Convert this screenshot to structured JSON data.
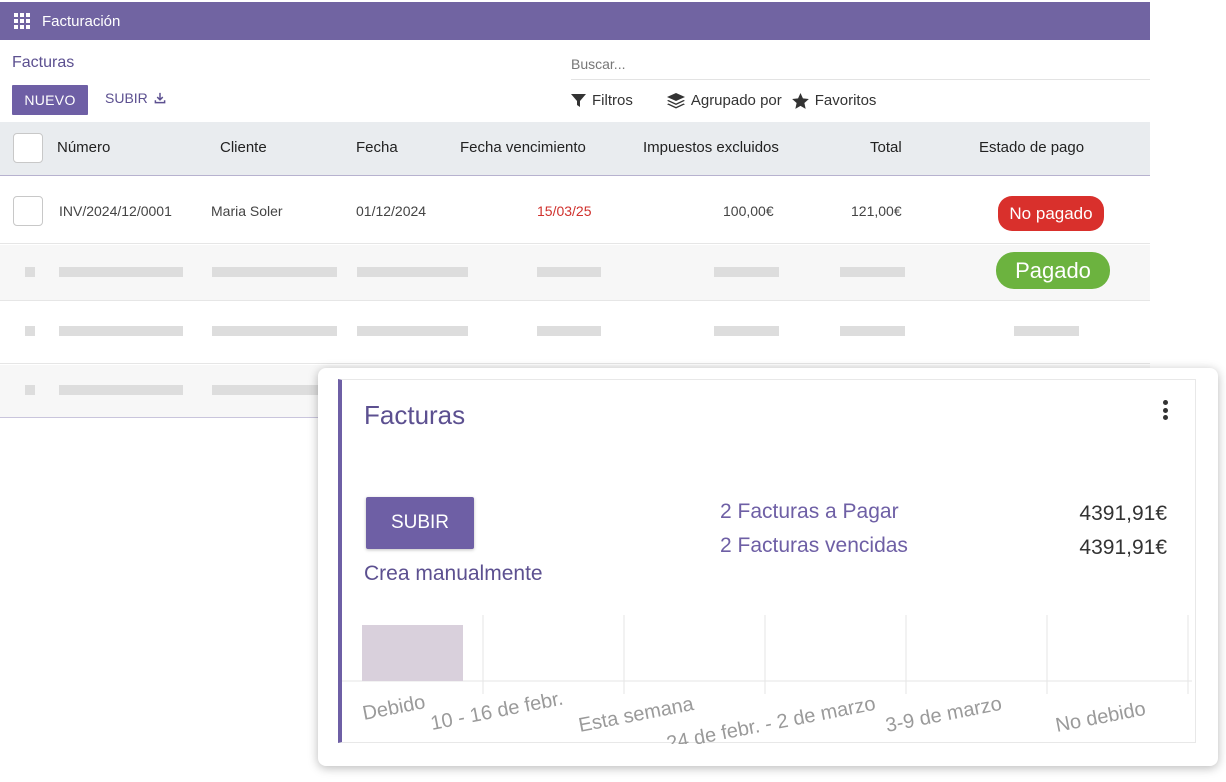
{
  "topbar": {
    "app_title": "Facturación",
    "apps_icon": "grid-icon"
  },
  "control": {
    "breadcrumb": "Facturas",
    "new_label": "NUEVO",
    "upload_label": "SUBIR",
    "search_placeholder": "Buscar...",
    "filters": "Filtros",
    "group_by": "Agrupado por",
    "favorites": "Favoritos"
  },
  "table": {
    "columns": [
      "Número",
      "Cliente",
      "Fecha",
      "Fecha vencimiento",
      "Impuestos excluidos",
      "Total",
      "Estado de pago"
    ],
    "rows": [
      {
        "number": "INV/2024/12/0001",
        "client": "Maria Soler",
        "date": "01/12/2024",
        "due": "15/03/25",
        "untaxed": "100,00€",
        "total": "121,00€",
        "status": "No pagado"
      }
    ],
    "placeholder_status": "Pagado",
    "colors": {
      "unpaid": "#d9302c",
      "paid": "#6cb33f",
      "due_overdue": "#d0312d"
    }
  },
  "card": {
    "title": "Facturas",
    "upload_label": "SUBIR",
    "manual_label": "Crea manualmente",
    "stats": [
      {
        "label": "2 Facturas a Pagar",
        "value": "4391,91€"
      },
      {
        "label": "2 Facturas vencidas",
        "value": "4391,91€"
      }
    ],
    "menu_icon": "kebab-icon"
  },
  "chart_data": {
    "type": "bar",
    "categories": [
      "Debido",
      "10 - 16 de febr.",
      "Esta semana",
      "24 de febr. - 2 de marzo",
      "3-9 de marzo",
      "No debido"
    ],
    "values": [
      1,
      0,
      0,
      0,
      0,
      0
    ],
    "bar_color": "#d9d0dc",
    "grid": true
  }
}
